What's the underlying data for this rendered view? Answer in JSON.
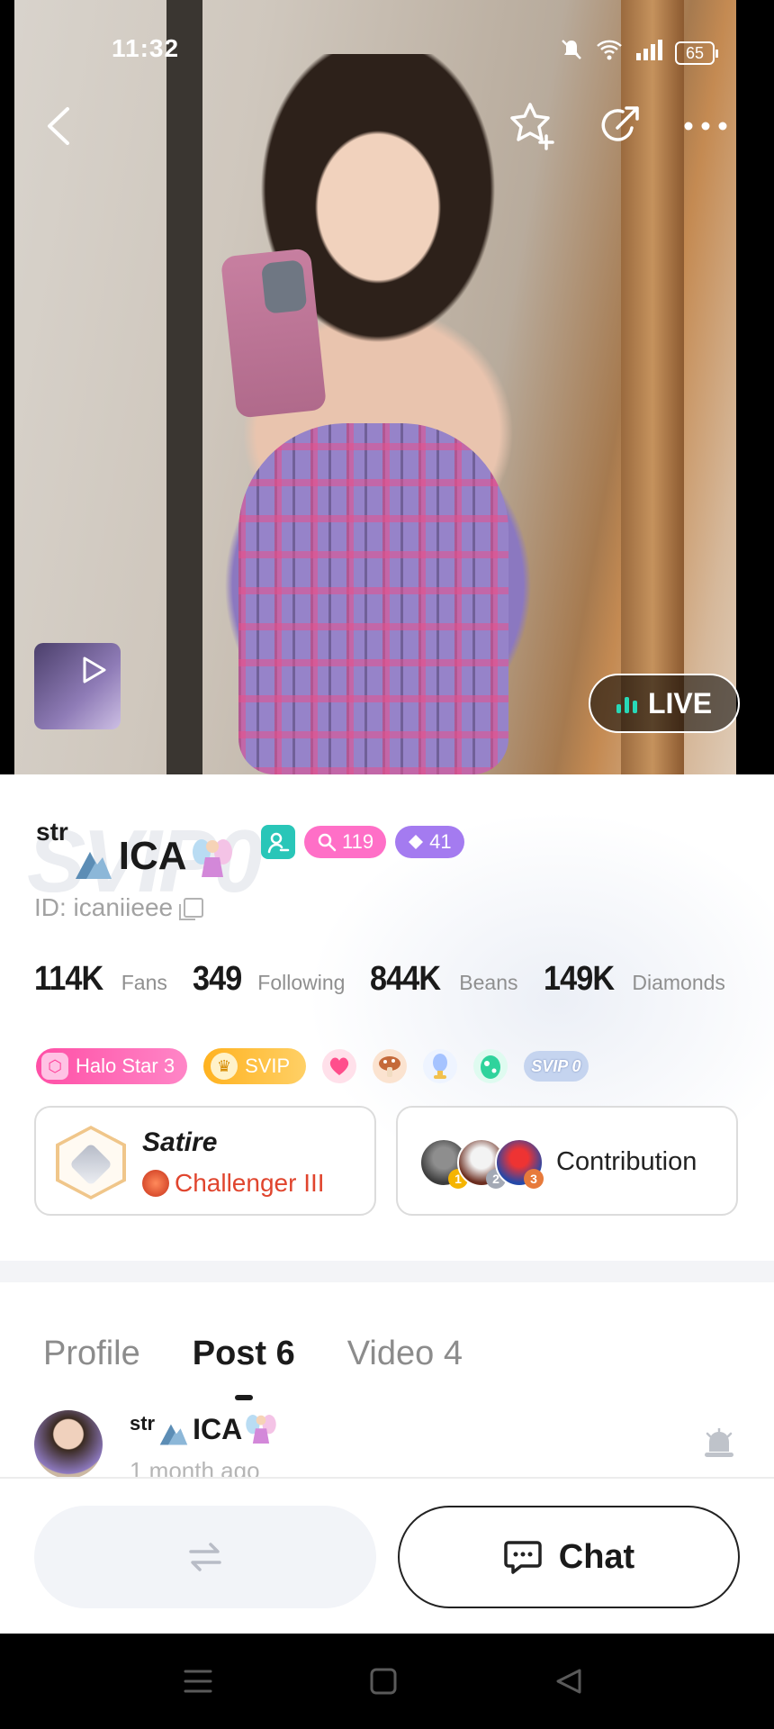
{
  "status_bar": {
    "time": "11:32",
    "battery": "65"
  },
  "hero": {
    "live_label": "LIVE"
  },
  "profile": {
    "name_prefix": "str",
    "name_main": "ICA",
    "search_count": "119",
    "diamond_count": "41",
    "watermark": "SVIP0",
    "id_text": "ID: icaniieee",
    "stats": [
      {
        "value": "114K",
        "label": "Fans"
      },
      {
        "value": "349",
        "label": "Following"
      },
      {
        "value": "844K",
        "label": "Beans"
      },
      {
        "value": "149K",
        "label": "Diamonds"
      }
    ],
    "medals": {
      "halo": "Halo Star 3",
      "svip": "SVIP",
      "svip0": "SVIP 0"
    },
    "rank": {
      "title": "Satire",
      "tier": "Challenger III"
    },
    "contribution": {
      "label": "Contribution",
      "ranks": [
        "1",
        "2",
        "3"
      ]
    }
  },
  "tabs": [
    {
      "label": "Profile",
      "active": false
    },
    {
      "label": "Post 6",
      "active": true
    },
    {
      "label": "Video 4",
      "active": false
    }
  ],
  "post": {
    "author_prefix": "str",
    "author_name": "ICA",
    "time": "1 month ago"
  },
  "actions": {
    "chat_label": "Chat"
  },
  "colors": {
    "live_bars": "#28d8b7",
    "halo_pink": "#ff4fa6",
    "svip_gold": "#ffb21f",
    "rank_red": "#e0452e"
  }
}
